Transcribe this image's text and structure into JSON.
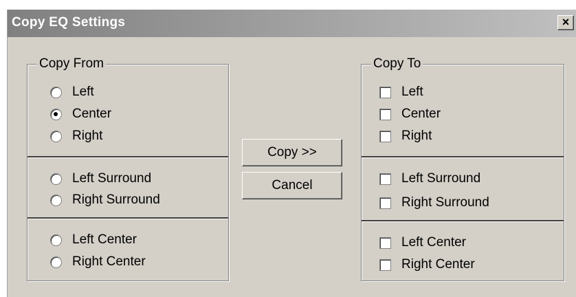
{
  "window": {
    "title": "Copy EQ Settings",
    "close_label": "×"
  },
  "copy_from": {
    "legend": "Copy From",
    "groups": [
      [
        {
          "label": "Left",
          "checked": false
        },
        {
          "label": "Center",
          "checked": true
        },
        {
          "label": "Right",
          "checked": false
        }
      ],
      [
        {
          "label": "Left Surround",
          "checked": false
        },
        {
          "label": "Right Surround",
          "checked": false
        }
      ],
      [
        {
          "label": "Left Center",
          "checked": false
        },
        {
          "label": "Right Center",
          "checked": false
        }
      ]
    ]
  },
  "copy_to": {
    "legend": "Copy To",
    "groups": [
      [
        {
          "label": "Left",
          "checked": false
        },
        {
          "label": "Center",
          "checked": false
        },
        {
          "label": "Right",
          "checked": false
        }
      ],
      [
        {
          "label": "Left Surround",
          "checked": false
        },
        {
          "label": "Right Surround",
          "checked": false
        }
      ],
      [
        {
          "label": "Left Center",
          "checked": false
        },
        {
          "label": "Right Center",
          "checked": false
        }
      ]
    ]
  },
  "buttons": {
    "copy": "Copy >>",
    "cancel": "Cancel"
  }
}
